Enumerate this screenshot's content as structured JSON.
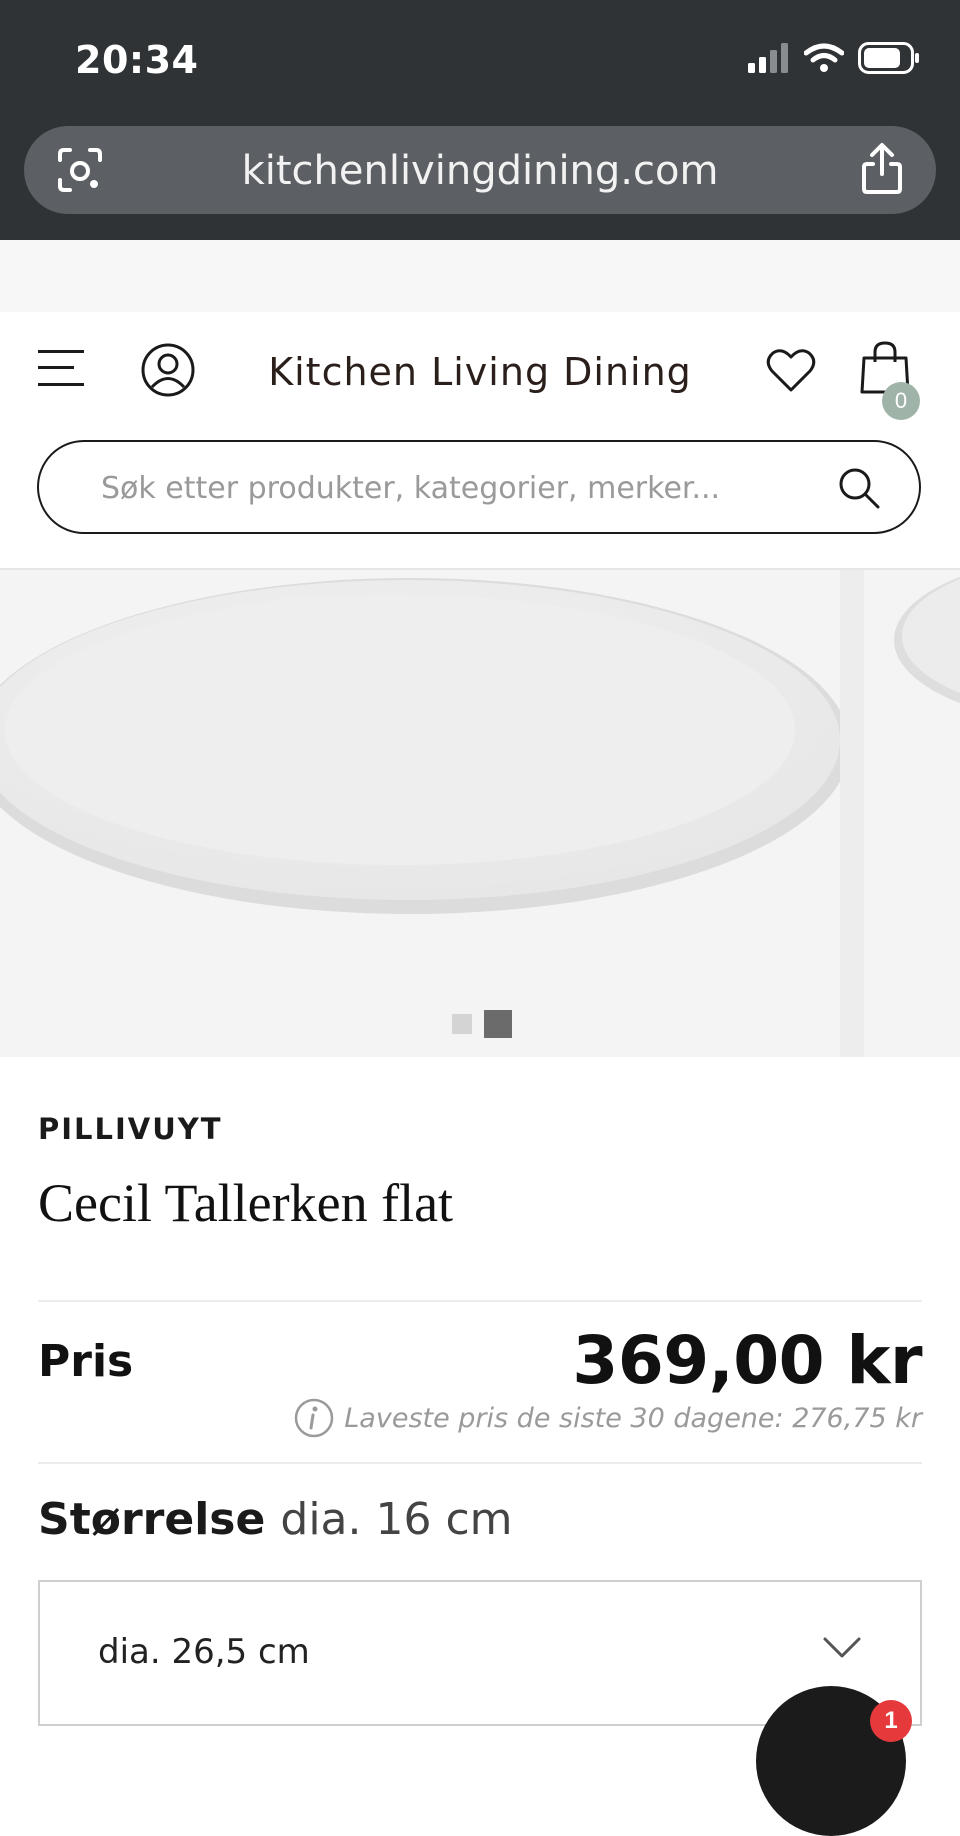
{
  "status_bar": {
    "time": "20:34",
    "icons": [
      "signal-icon",
      "wifi-icon",
      "battery-icon"
    ]
  },
  "browser": {
    "url": "kitchenlivingdining.com",
    "left_button_icon": "lens-icon",
    "right_button_icon": "share-icon"
  },
  "header": {
    "logo": "Kitchen Living Dining",
    "menu_icon": "hamburger-icon",
    "account_icon": "account-icon",
    "favorites_icon": "heart-icon",
    "cart_icon": "shopping-bag-icon",
    "cart_count": "0"
  },
  "search": {
    "placeholder": "Søk etter produkter, kategorier, merker...",
    "value": ""
  },
  "gallery": {
    "slide_count": 2,
    "active_slide": 2
  },
  "product": {
    "brand": "PILLIVUYT",
    "title": "Cecil Tallerken flat",
    "price_label": "Pris",
    "price": "369,00 kr",
    "lowest_price_note": "Laveste pris de siste 30 dagene: 276,75 kr",
    "size_label": "Størrelse",
    "size_value": "dia. 16 cm",
    "size_selected": "dia. 26,5 cm"
  },
  "chat": {
    "badge_count": "1"
  },
  "colors": {
    "statusbar_bg": "#2f3335",
    "urlbar_bg": "#5c6064",
    "cart_badge": "#9fb3a8",
    "chat_badge": "#e6393b"
  }
}
